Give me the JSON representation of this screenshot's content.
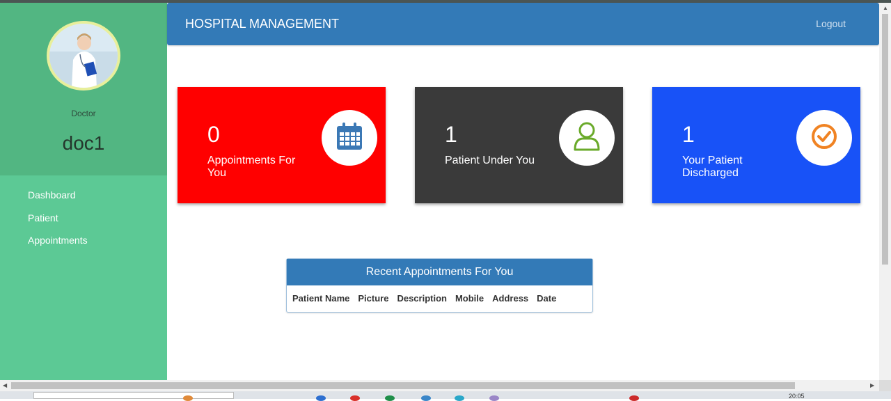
{
  "sidebar": {
    "role": "Doctor",
    "username": "doc1",
    "items": [
      {
        "label": "Dashboard"
      },
      {
        "label": "Patient"
      },
      {
        "label": "Appointments"
      }
    ]
  },
  "header": {
    "title": "HOSPITAL MANAGEMENT",
    "logout_label": "Logout"
  },
  "cards": [
    {
      "value": "0",
      "label": "Appointments For You",
      "color": "#ff0000",
      "icon": "calendar-icon",
      "icon_color": "#3b78b5"
    },
    {
      "value": "1",
      "label": "Patient Under You",
      "color": "#3a3a3a",
      "icon": "user-icon",
      "icon_color": "#6aaa2a"
    },
    {
      "value": "1",
      "label": "Your Patient Discharged",
      "color": "#1852f7",
      "icon": "check-circle-icon",
      "icon_color": "#f08323"
    }
  ],
  "recent": {
    "title": "Recent Appointments For You",
    "columns": [
      "Patient Name",
      "Picture",
      "Description",
      "Mobile",
      "Address",
      "Date"
    ]
  },
  "taskbar": {
    "time": "20:05"
  }
}
